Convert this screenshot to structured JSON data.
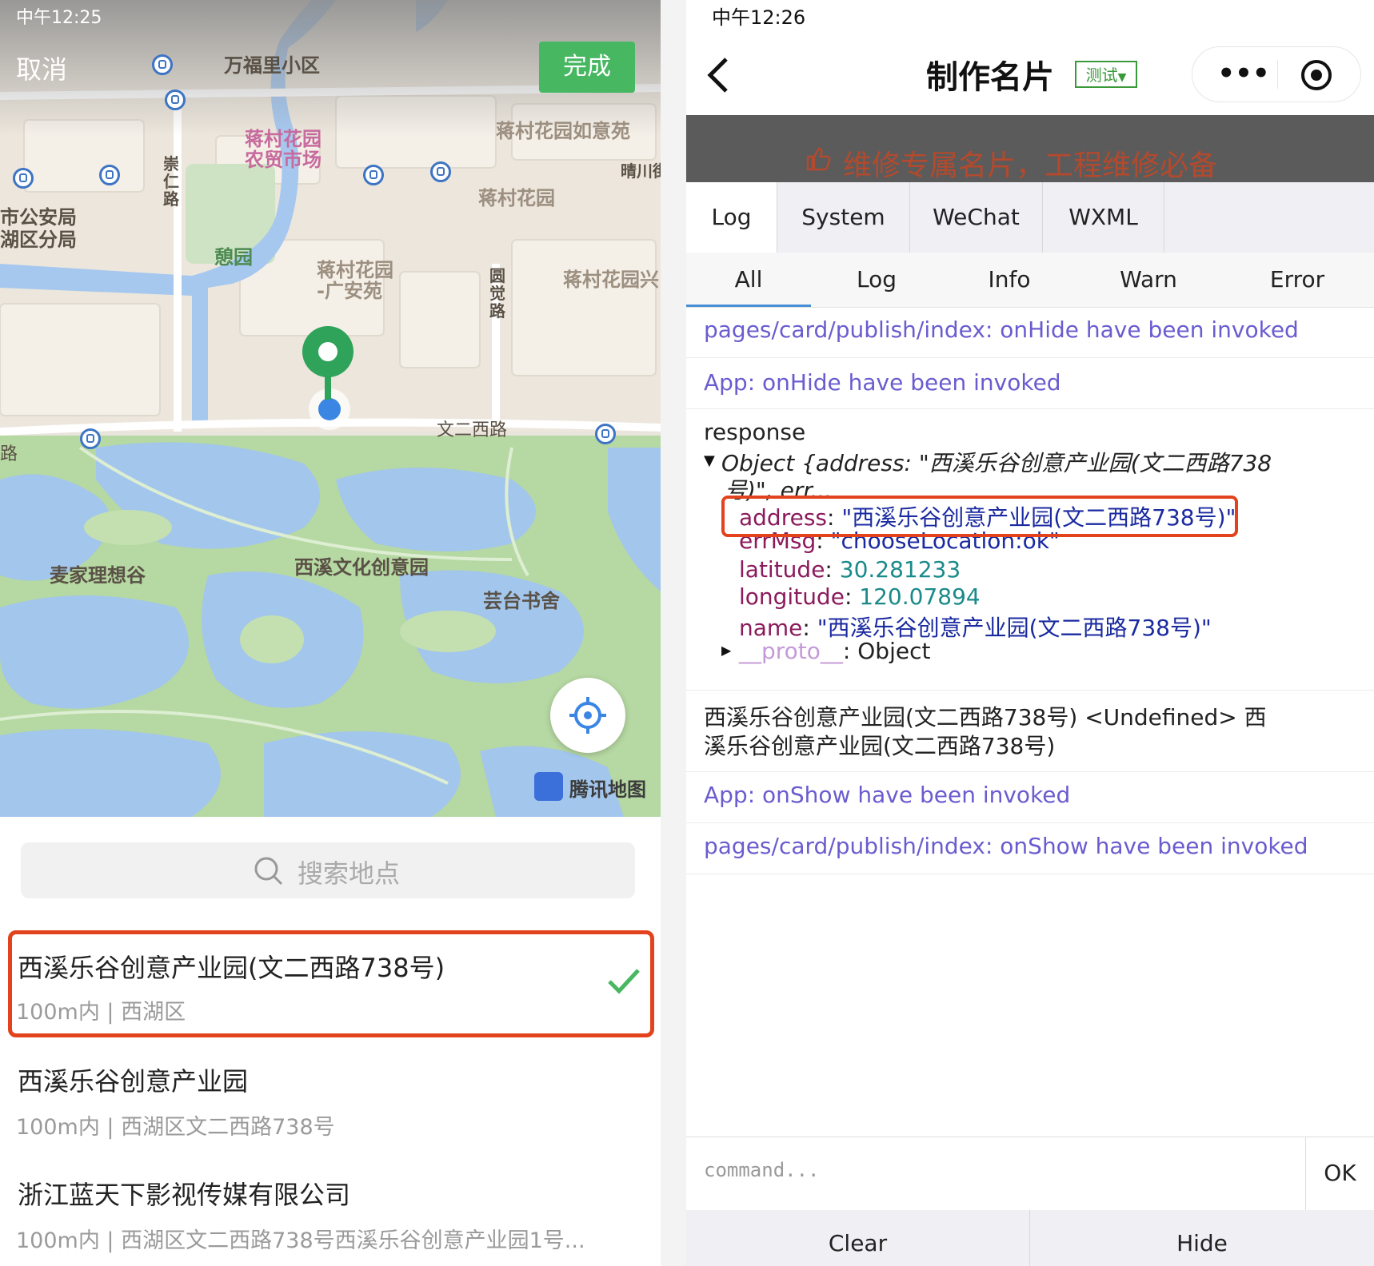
{
  "left": {
    "status_time": "中午12:25",
    "cancel_label": "取消",
    "done_label": "完成",
    "map_labels": {
      "wanfuli": "万福里小区",
      "jiangcun_market_1": "蒋村花园",
      "jiangcun_market_2": "农贸市场",
      "jiangcun_ruyi": "蒋村花园如意苑",
      "qingchuan": "晴川街",
      "jiangcun_garden": "蒋村花园",
      "police_1": "市公安局",
      "police_2": "湖区分局",
      "chongren_road": "崇仁路",
      "qiyuan": "憩园",
      "guanganyuan_1": "蒋村花园",
      "guanganyuan_2": "-广安苑",
      "yuanjue_road": "圆觉路",
      "jiangcun_xing": "蒋村花园兴",
      "wenerxi_road": "文二西路",
      "road_left": "路",
      "maijia": "麦家理想谷",
      "xixi_culture": "西溪文化创意园",
      "yuntai": "芸台书舍",
      "tencent_map": "腾讯地图"
    },
    "search_placeholder": "搜索地点",
    "places": [
      {
        "title": "西溪乐谷创意产业园(文二西路738号)",
        "subtitle": "100m内 | 西湖区"
      },
      {
        "title": "西溪乐谷创意产业园",
        "subtitle": "100m内 | 西湖区文二西路738号"
      },
      {
        "title": "浙江蓝天下影视传媒有限公司",
        "subtitle": "100m内 | 西湖区文二西路738号西溪乐谷创意产业园1号..."
      }
    ]
  },
  "right": {
    "status_time": "中午12:26",
    "title": "制作名片",
    "badge": "测试",
    "banner": "维修专属名片，工程维修必备",
    "tabs": [
      "Log",
      "System",
      "WeChat",
      "WXML"
    ],
    "subtabs": [
      "All",
      "Log",
      "Info",
      "Warn",
      "Error"
    ],
    "logs": {
      "line1": "pages/card/publish/index: onHide have been invoked",
      "line2": "App: onHide have been invoked",
      "response_label": "response",
      "object_summary_1": "Object {address: \"西溪乐谷创意产业园(文二西路738",
      "object_summary_2": "号)\", err...",
      "address_key": "address",
      "address_value": "\"西溪乐谷创意产业园(文二西路738号)\"",
      "errmsg_key": "errMsg",
      "errmsg_value": "\"chooseLocation:ok\"",
      "latitude_key": "latitude",
      "latitude_value": "30.281233",
      "longitude_key": "longitude",
      "longitude_value": "120.07894",
      "name_key": "name",
      "name_value": "\"西溪乐谷创意产业园(文二西路738号)\"",
      "proto_key": "__proto__",
      "proto_value": "Object",
      "printed_1": "西溪乐谷创意产业园(文二西路738号) <Undefined> 西",
      "printed_2": "溪乐谷创意产业园(文二西路738号)",
      "line_show_app": "App: onShow have been invoked",
      "line_show_page": "pages/card/publish/index: onShow have been invoked"
    },
    "command_placeholder": "command...",
    "ok_label": "OK",
    "clear_label": "Clear",
    "hide_label": "Hide"
  },
  "colors": {
    "accent_green": "#47b762",
    "highlight_red": "#e2431d",
    "info_purple": "#6a5ccf",
    "tab_underline": "#4a90d9"
  }
}
